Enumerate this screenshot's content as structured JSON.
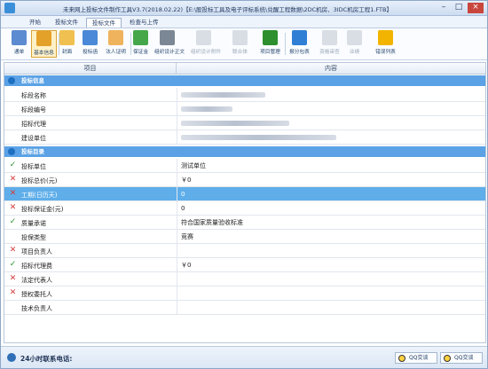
{
  "window": {
    "title": "未来网上投标文件制作工具V3.7(2018.02.22)【E:\\股投标工具及电子评标系统\\兑醒工程数据\\2DC机房、3IDC机房工程1.FTB】",
    "minimize": "–",
    "maximize": "□",
    "close": "×"
  },
  "menu": {
    "tabs": [
      {
        "label": "开始"
      },
      {
        "label": "投标文件"
      },
      {
        "label": "投标文件"
      },
      {
        "label": "检查与上传"
      }
    ]
  },
  "toolbar": {
    "items": [
      {
        "label": "通单",
        "icon": "notice-icon",
        "color": "#5d8bd1"
      },
      {
        "label": "基本信息",
        "icon": "document-icon",
        "color": "#e4a12a"
      },
      {
        "label": "封面",
        "icon": "cover-icon",
        "color": "#f0c050"
      },
      {
        "label": "投标函",
        "icon": "letter-icon",
        "color": "#4a89d7"
      },
      {
        "label": "法人证明",
        "icon": "person-icon",
        "color": "#f0b35d"
      },
      {
        "label": "保证金",
        "icon": "money-icon",
        "color": "#46a74a"
      },
      {
        "label": "组织设计正文",
        "icon": "pen-icon",
        "color": "#7b8794"
      },
      {
        "label": "组织设计附件",
        "icon": "attachment-icon",
        "color": "#9aa6b4"
      },
      {
        "label": "联合体",
        "icon": "people-icon",
        "color": "#9aa6b4"
      },
      {
        "label": "项目管理",
        "icon": "org-chart-icon",
        "color": "#2d8f2d"
      },
      {
        "label": "报分包表",
        "icon": "pie-chart-icon",
        "color": "#2f7fd4"
      },
      {
        "label": "资格审查",
        "icon": "tools-icon",
        "color": "#9aa6b4"
      },
      {
        "label": "业绩",
        "icon": "trophy-icon",
        "color": "#9aa6b4"
      },
      {
        "label": "错误列表",
        "icon": "warning-icon",
        "color": "#f2b400"
      }
    ]
  },
  "grid": {
    "col_item": "项目",
    "col_content": "内容"
  },
  "sections": [
    {
      "title": "投标信息",
      "rows": [
        {
          "label": "标段名称",
          "value": "",
          "blur": 95
        },
        {
          "label": "标段编号",
          "value": "",
          "blur": 58
        },
        {
          "label": "招标代理",
          "value": "",
          "blur": 122
        },
        {
          "label": "建设单位",
          "value": "",
          "blur": 175
        }
      ]
    },
    {
      "title": "投标目录",
      "rows": [
        {
          "status": "ok",
          "label": "投标单位",
          "value": "测试单位"
        },
        {
          "status": "bad",
          "label": "投标总价(元)",
          "value": "￥0"
        },
        {
          "status": "bad",
          "label": "工期(日历天)",
          "value": "0",
          "selected": true
        },
        {
          "status": "bad",
          "label": "投标保证金(元)",
          "value": "0"
        },
        {
          "status": "ok",
          "label": "质量承诺",
          "value": "符合国家质量验收标准"
        },
        {
          "status": "",
          "label": "投保类型",
          "value": "竞赛"
        },
        {
          "status": "bad",
          "label": "项目负责人",
          "value": ""
        },
        {
          "status": "ok",
          "label": "招标代理费",
          "value": "￥0"
        },
        {
          "status": "bad",
          "label": "法定代表人",
          "value": ""
        },
        {
          "status": "bad",
          "label": "授权委托人",
          "value": ""
        },
        {
          "status": "",
          "label": "技术负责人",
          "value": ""
        }
      ]
    }
  ],
  "status": {
    "phone_label": "24小时联系电话:",
    "qq1": "QQ交谈",
    "qq2": "QQ交谈"
  }
}
